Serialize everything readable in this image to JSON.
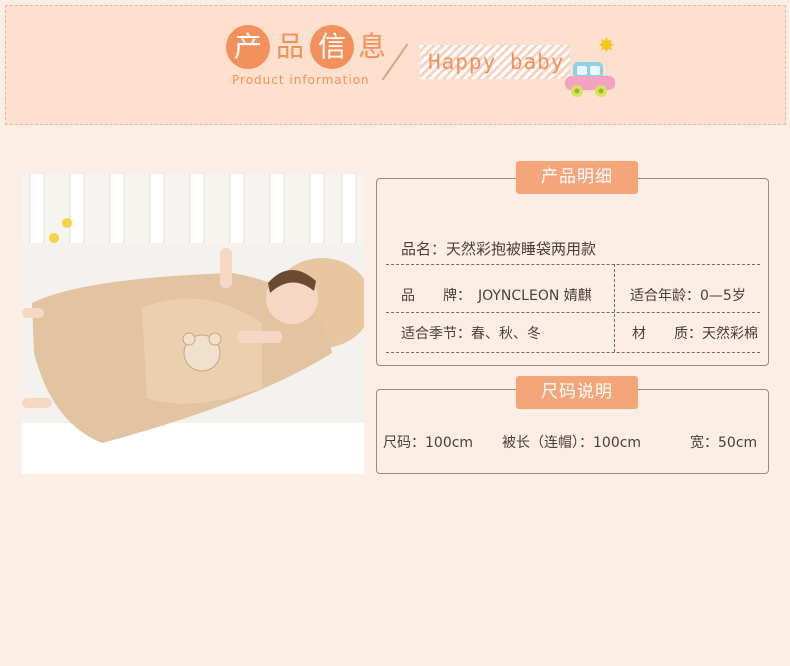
{
  "header": {
    "title_chars": [
      "产",
      "品",
      "信",
      "息"
    ],
    "title_en": "Product information",
    "slogan": "Happy baby"
  },
  "detail": {
    "heading": "产品明细",
    "name": "品名：天然彩抱被睡袋两用款",
    "brand_label": "品　　牌：",
    "brand_value": "JOYNCLEON 婧麒",
    "age": "适合年龄：0—5岁",
    "season": "适合季节：春、秋、冬",
    "material": "材　　质：天然彩棉"
  },
  "size": {
    "heading": "尺码说明",
    "size": "尺码：100cm",
    "length": "被长（连帽）：100cm",
    "width": "宽：50cm"
  },
  "colors": {
    "accent": "#f4905b",
    "pill": "#f4a67a",
    "background": "#fbeee4",
    "banner": "#fde0cd"
  }
}
